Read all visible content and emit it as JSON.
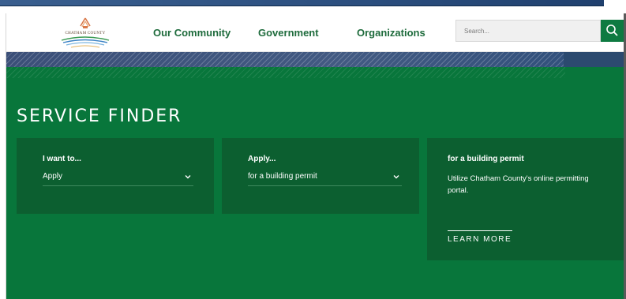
{
  "header": {
    "logo_text": "CHATHAM COUNTY",
    "nav": [
      {
        "label": "Our Community"
      },
      {
        "label": "Government"
      },
      {
        "label": "Organizations"
      }
    ],
    "search": {
      "placeholder": "Search..."
    }
  },
  "service_finder": {
    "title": "SERVICE FINDER",
    "card1": {
      "label": "I want to...",
      "selected": "Apply"
    },
    "card2": {
      "label": "Apply...",
      "selected": "for a building permit"
    },
    "result": {
      "title": "for a building permit",
      "description": "Utilize Chatham County's online permitting portal.",
      "link_label": "LEARN MORE"
    }
  },
  "colors": {
    "page_green": "#08763b",
    "card_green": "#0c5f30",
    "nav_text": "#1e6b3c",
    "search_button": "#0e7a41"
  },
  "icons": [
    "chatham-county-logo",
    "search-icon",
    "chevron-down-icon"
  ]
}
